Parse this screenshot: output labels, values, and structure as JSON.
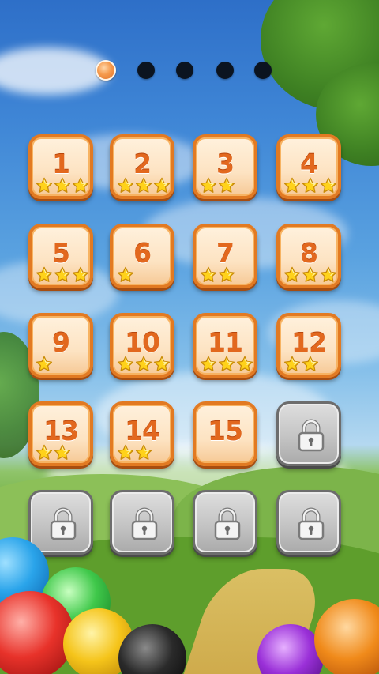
{
  "pagination": {
    "count": 5,
    "active_index": 0
  },
  "levels": [
    {
      "label": "1",
      "stars": 3,
      "locked": false
    },
    {
      "label": "2",
      "stars": 3,
      "locked": false
    },
    {
      "label": "3",
      "stars": 2,
      "locked": false
    },
    {
      "label": "4",
      "stars": 3,
      "locked": false
    },
    {
      "label": "5",
      "stars": 3,
      "locked": false
    },
    {
      "label": "6",
      "stars": 1,
      "locked": false
    },
    {
      "label": "7",
      "stars": 2,
      "locked": false
    },
    {
      "label": "8",
      "stars": 3,
      "locked": false
    },
    {
      "label": "9",
      "stars": 1,
      "locked": false
    },
    {
      "label": "10",
      "stars": 3,
      "locked": false
    },
    {
      "label": "11",
      "stars": 3,
      "locked": false
    },
    {
      "label": "12",
      "stars": 2,
      "locked": false
    },
    {
      "label": "13",
      "stars": 2,
      "locked": false
    },
    {
      "label": "14",
      "stars": 2,
      "locked": false
    },
    {
      "label": "15",
      "stars": 0,
      "locked": false
    },
    {
      "label": "",
      "stars": 0,
      "locked": true
    },
    {
      "label": "",
      "stars": 0,
      "locked": true
    },
    {
      "label": "",
      "stars": 0,
      "locked": true
    },
    {
      "label": "",
      "stars": 0,
      "locked": true
    },
    {
      "label": "",
      "stars": 0,
      "locked": true
    }
  ],
  "icons": {
    "star": "star-icon",
    "lock": "padlock-icon"
  },
  "colors": {
    "tile_border": "#e27a22",
    "level_number": "#e2681e",
    "star": "#ffd21a",
    "locked_tile": "#c4c4c4",
    "active_dot": "#f59a4d",
    "inactive_dot": "#0b1420"
  }
}
